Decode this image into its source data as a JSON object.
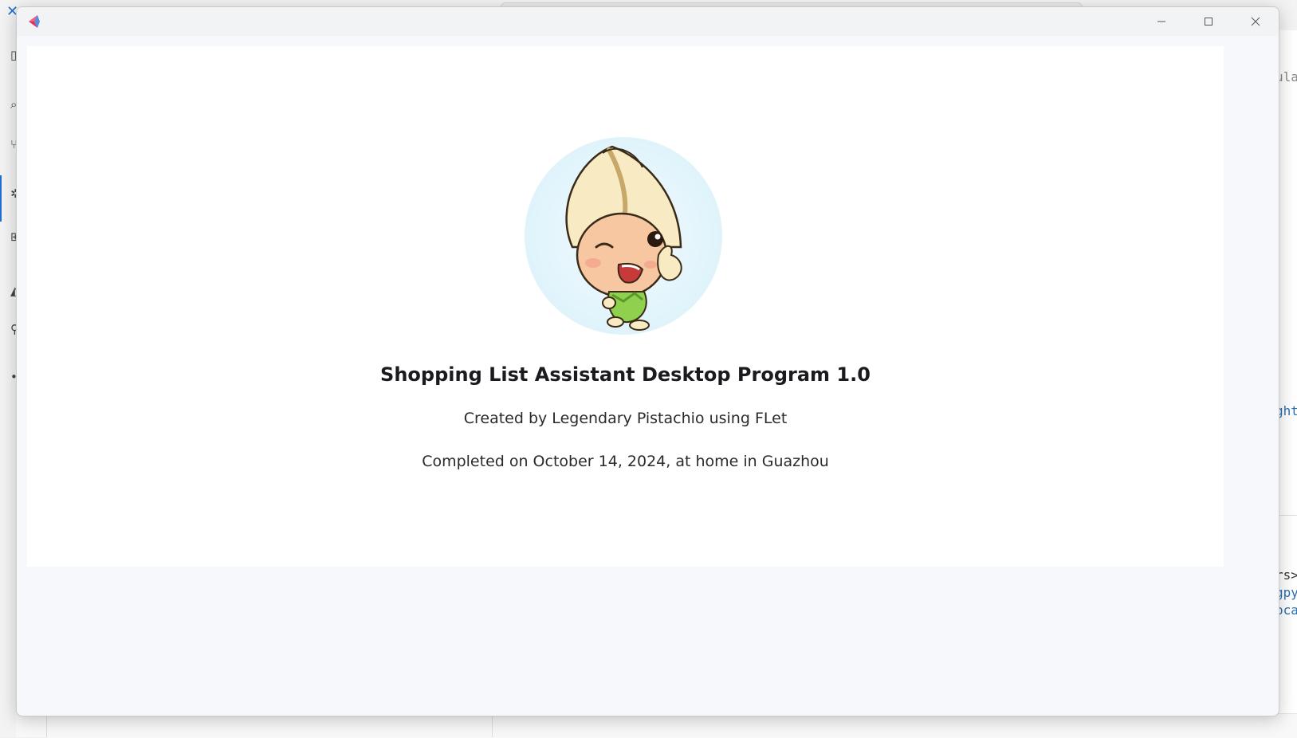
{
  "background": {
    "right_fragments": [
      "ular",
      "ght",
      "rs>",
      "gpy",
      "oca"
    ]
  },
  "window": {
    "controls": {
      "minimize": "minimize",
      "maximize": "maximize",
      "close": "close"
    }
  },
  "about": {
    "title": "Shopping List Assistant Desktop Program 1.0",
    "created_by": "Created by Legendary Pistachio using FLet",
    "completed_on": "Completed on October 14, 2024, at home in Guazhou"
  },
  "colors": {
    "accent_blue": "#1f6fd1",
    "logo_red": "#e8315a",
    "logo_blue": "#3a7bd5",
    "mascot_skin": "#f6c7a0",
    "mascot_leaf": "#8fd14f"
  }
}
